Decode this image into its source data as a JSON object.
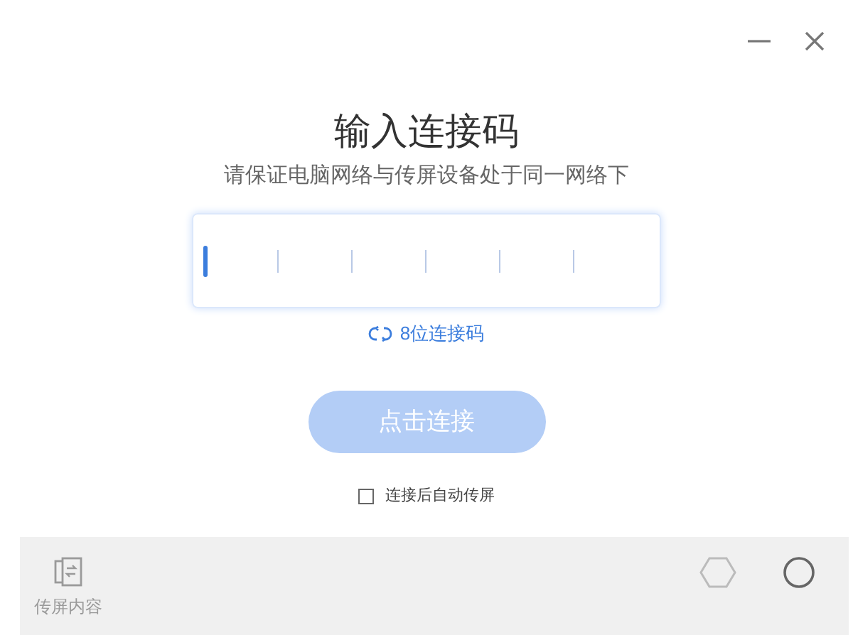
{
  "window": {
    "controls": [
      {
        "kind": "minimize"
      },
      {
        "kind": "close"
      }
    ]
  },
  "title": "输入连接码",
  "subtitle": "请保证电脑网络与传屏设备处于同一网络下",
  "code_input": {
    "slots": [
      {
        "selected": true
      },
      {
        "selected": false
      },
      {
        "selected": false
      },
      {
        "selected": false
      },
      {
        "selected": false
      },
      {
        "selected": false
      }
    ]
  },
  "switch_link": "8位连接码",
  "connect_button": {
    "label": "点击连接",
    "disabled": true
  },
  "auto_cast": {
    "label": "连接后自动传屏",
    "checked": false
  },
  "bottom_bar": {
    "items": [
      {
        "label": "传屏内容",
        "disabled": true
      }
    ]
  }
}
